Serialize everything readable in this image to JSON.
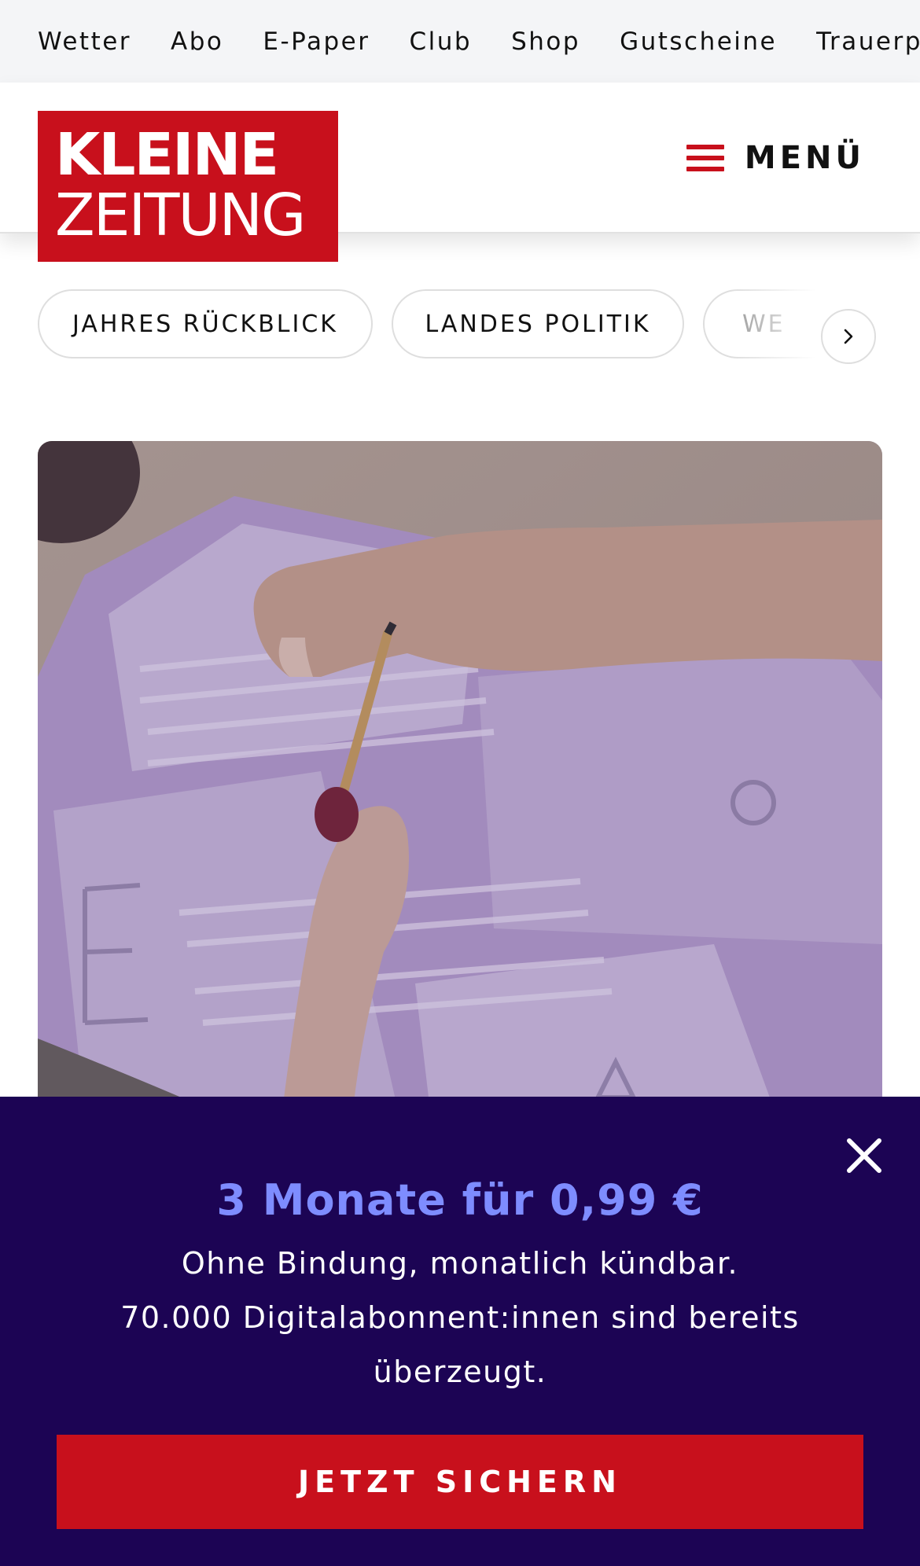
{
  "topbar": {
    "links": [
      "Wetter",
      "Abo",
      "E-Paper",
      "Club",
      "Shop",
      "Gutscheine",
      "Trauerp"
    ]
  },
  "header": {
    "logo": {
      "line1": "KLEINE",
      "line2": "ZEITUNG"
    },
    "menu_label": "MENÜ"
  },
  "topics": {
    "chips": [
      "JAHRES RÜCKBLICK",
      "LANDES POLITIK",
      "WE"
    ]
  },
  "paywall": {
    "title": "3 Monate für 0,99 €",
    "line1": "Ohne Bindung, monatlich kündbar.",
    "line2": "70.000 Digitalabonnent:innen sind bereits überzeugt.",
    "cta_label": "JETZT SICHERN"
  },
  "colors": {
    "brand_red": "#c8101c",
    "paywall_bg": "#1c0454",
    "offer_accent": "#7e8cff"
  }
}
